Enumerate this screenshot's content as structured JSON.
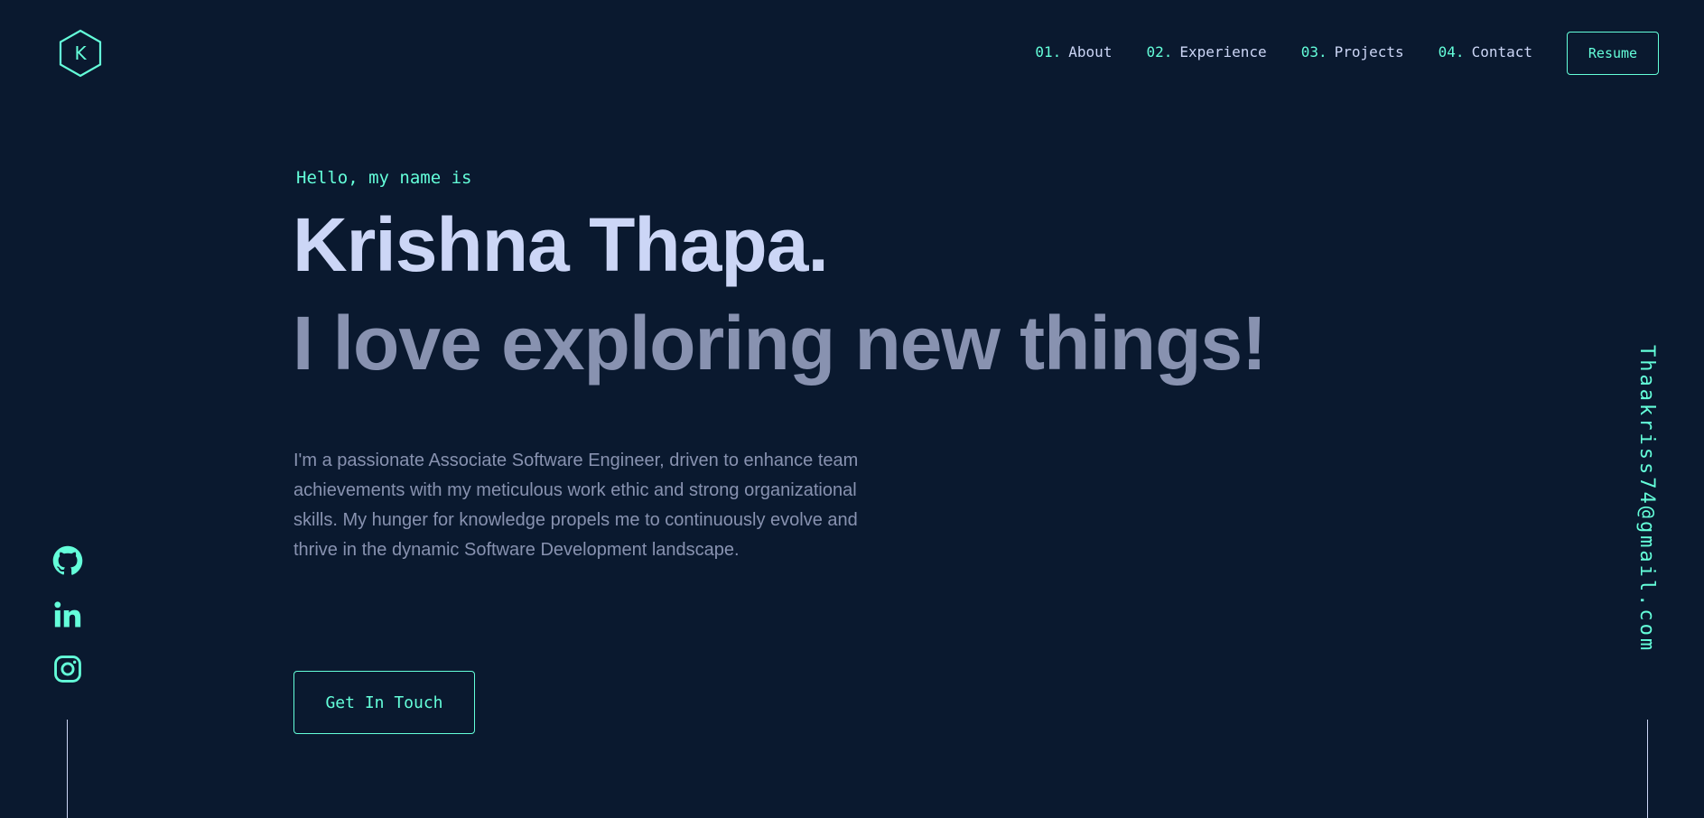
{
  "header": {
    "logo_letter": "K",
    "nav": [
      {
        "num": "01.",
        "label": "About"
      },
      {
        "num": "02.",
        "label": "Experience"
      },
      {
        "num": "03.",
        "label": "Projects"
      },
      {
        "num": "04.",
        "label": "Contact"
      }
    ],
    "resume_label": "Resume"
  },
  "hero": {
    "greeting": "Hello, my name is",
    "name": "Krishna Thapa.",
    "tagline": "I love exploring new things!",
    "bio": "I'm a passionate Associate Software Engineer, driven to enhance team achievements with my meticulous work ethic and strong organizational skills. My hunger for knowledge propels me to continuously evolve and thrive in the dynamic Software Development landscape.",
    "cta_label": "Get In Touch"
  },
  "socials": [
    {
      "icon": "github-icon"
    },
    {
      "icon": "linkedin-icon"
    },
    {
      "icon": "instagram-icon"
    }
  ],
  "email": "Thaakriss74@gmail.com",
  "colors": {
    "background": "#0a192f",
    "accent": "#64ffda",
    "heading": "#ccd6f6",
    "body": "#8892b0"
  }
}
